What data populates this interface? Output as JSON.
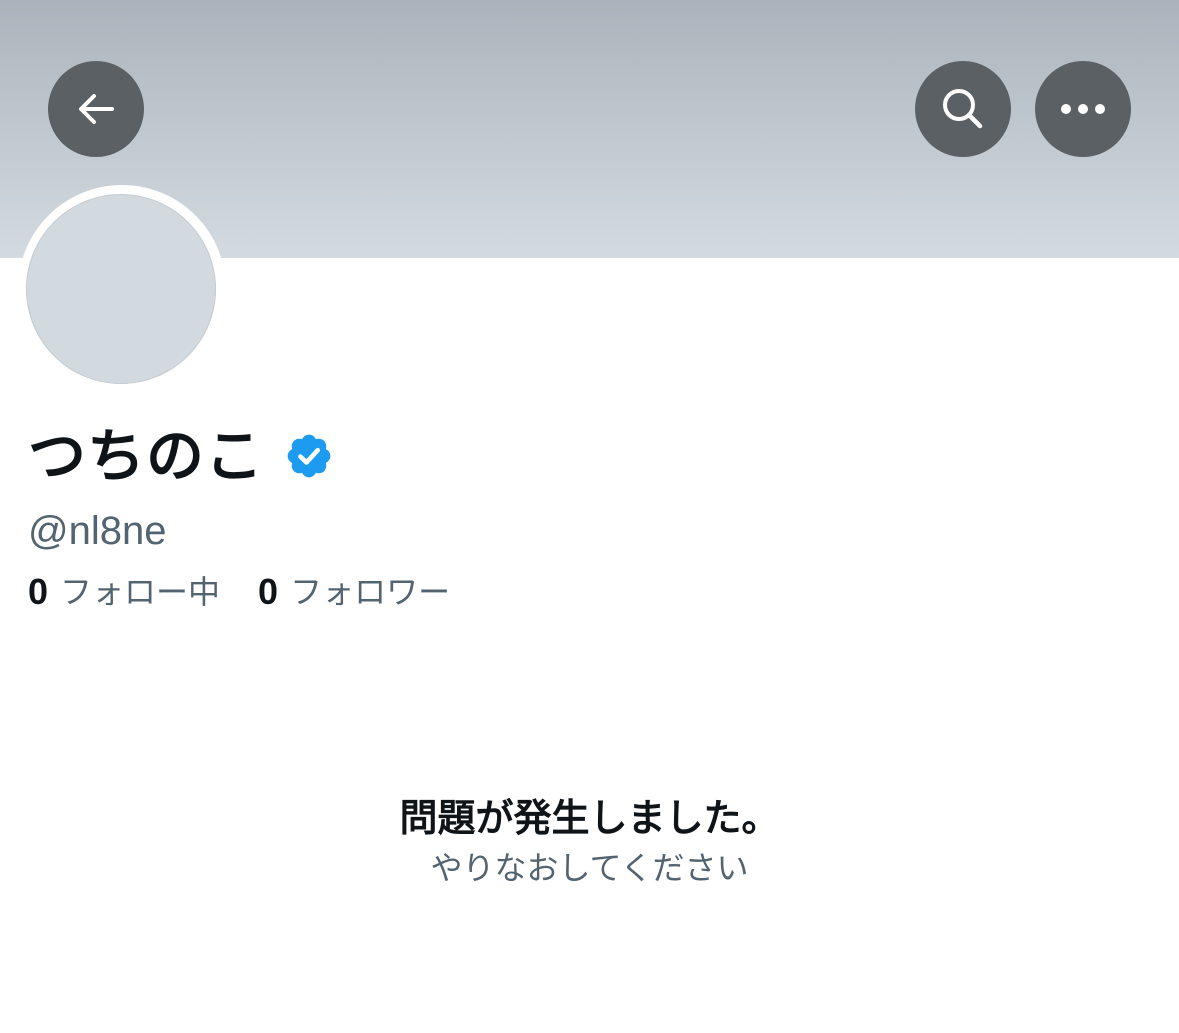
{
  "header": {
    "back_icon": "arrow-left-icon",
    "search_icon": "search-icon",
    "more_icon": "more-horizontal-icon",
    "button_color": "#5b6064",
    "banner_color": "#c2cad1"
  },
  "profile": {
    "display_name": "つちのこ",
    "verified_icon": "verified-badge-icon",
    "verified_color": "#1d9bf0",
    "handle": "@nl8ne",
    "following_count": "0",
    "following_label": "フォロー中",
    "followers_count": "0",
    "followers_label": "フォロワー"
  },
  "error": {
    "title": "問題が発生しました。",
    "retry_label": "やりなおしてください"
  }
}
